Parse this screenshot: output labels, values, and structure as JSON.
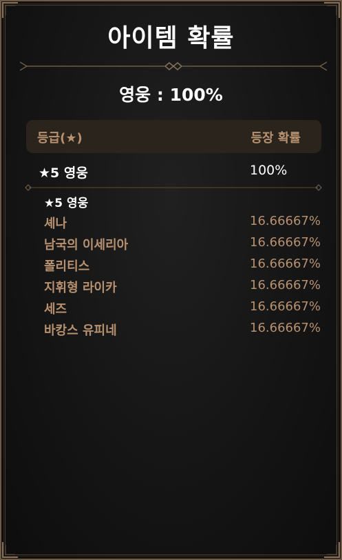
{
  "title": "아이템 확률",
  "summary": "영웅 : 100%",
  "table_header": {
    "grade_label": "등급(★)",
    "rate_label": "등장 확률"
  },
  "grade_group": {
    "name": "★5 영웅",
    "rate": "100%"
  },
  "sub_group_label": "★5 영웅",
  "items": [
    {
      "name": "셰나",
      "rate": "16.66667%"
    },
    {
      "name": "남국의 이세리아",
      "rate": "16.66667%"
    },
    {
      "name": "폴리티스",
      "rate": "16.66667%"
    },
    {
      "name": "지휘형 라이카",
      "rate": "16.66667%"
    },
    {
      "name": "세즈",
      "rate": "16.66667%"
    },
    {
      "name": "바캉스 유피네",
      "rate": "16.66667%"
    }
  ],
  "colors": {
    "background": "#151515",
    "frame": "#6e5a45",
    "header_bar": "#2b241d",
    "accent_text": "#b79170",
    "primary_text": "#ffffff"
  }
}
